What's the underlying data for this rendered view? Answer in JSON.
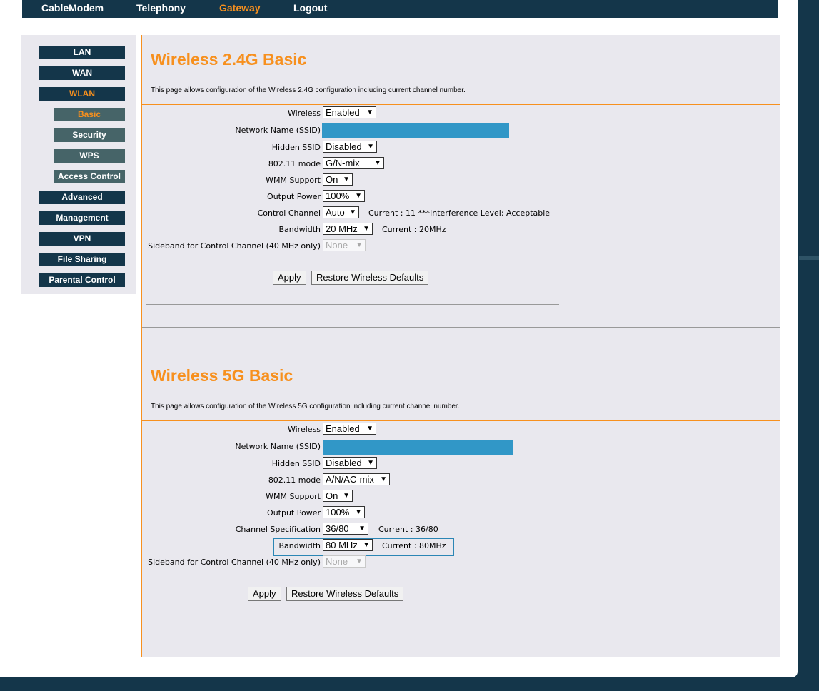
{
  "topnav": {
    "items": [
      "CableModem",
      "Telephony",
      "Gateway",
      "Logout"
    ]
  },
  "sidebar": {
    "items": {
      "lan": "LAN",
      "wan": "WAN",
      "wlan": "WLAN",
      "basic": "Basic",
      "security": "Security",
      "wps": "WPS",
      "access_control": "Access Control",
      "advanced": "Advanced",
      "management": "Management",
      "vpn": "VPN",
      "file_sharing": "File Sharing",
      "parental_control": "Parental Control"
    },
    "active_main": "WLAN",
    "active_sub": "Basic"
  },
  "band24": {
    "title": "Wireless 2.4G Basic",
    "description": "This page allows configuration of the Wireless 2.4G configuration including current channel number.",
    "wireless_label": "Wireless",
    "wireless_value": "Enabled",
    "ssid_label": "Network Name (SSID)",
    "hidden_label": "Hidden SSID",
    "hidden_value": "Disabled",
    "mode_label": "802.11 mode",
    "mode_value": "G/N-mix",
    "wmm_label": "WMM Support",
    "wmm_value": "On",
    "power_label": "Output Power",
    "power_value": "100%",
    "channel_label": "Control Channel",
    "channel_value": "Auto",
    "channel_current": "Current :  11 ***Interference Level: Acceptable",
    "bandwidth_label": "Bandwidth",
    "bandwidth_value": "20 MHz",
    "bandwidth_current": "Current :  20MHz",
    "sideband_label": "Sideband for Control Channel (40 MHz only)",
    "sideband_value": "None",
    "apply": "Apply",
    "restore": "Restore Wireless Defaults"
  },
  "band5": {
    "title": "Wireless 5G Basic",
    "description": "This page allows configuration of the Wireless 5G configuration including current channel number.",
    "wireless_label": "Wireless",
    "wireless_value": "Enabled",
    "ssid_label": "Network Name (SSID)",
    "hidden_label": "Hidden SSID",
    "hidden_value": "Disabled",
    "mode_label": "802.11 mode",
    "mode_value": "A/N/AC-mix",
    "wmm_label": "WMM Support",
    "wmm_value": "On",
    "power_label": "Output Power",
    "power_value": "100%",
    "channel_label": "Channel Specification",
    "channel_value": "36/80",
    "channel_current": "Current :  36/80",
    "bandwidth_label": "Bandwidth",
    "bandwidth_value": "80 MHz",
    "bandwidth_current": "Current :  80MHz",
    "sideband_label": "Sideband for Control Channel (40 MHz only)",
    "sideband_value": "None",
    "apply": "Apply",
    "restore": "Restore Wireless Defaults"
  },
  "colors": {
    "brand_dark": "#14364a",
    "accent_orange": "#f7901e",
    "ssid_mask_blue": "#3197c7",
    "highlight_blue": "#2b86b5"
  }
}
